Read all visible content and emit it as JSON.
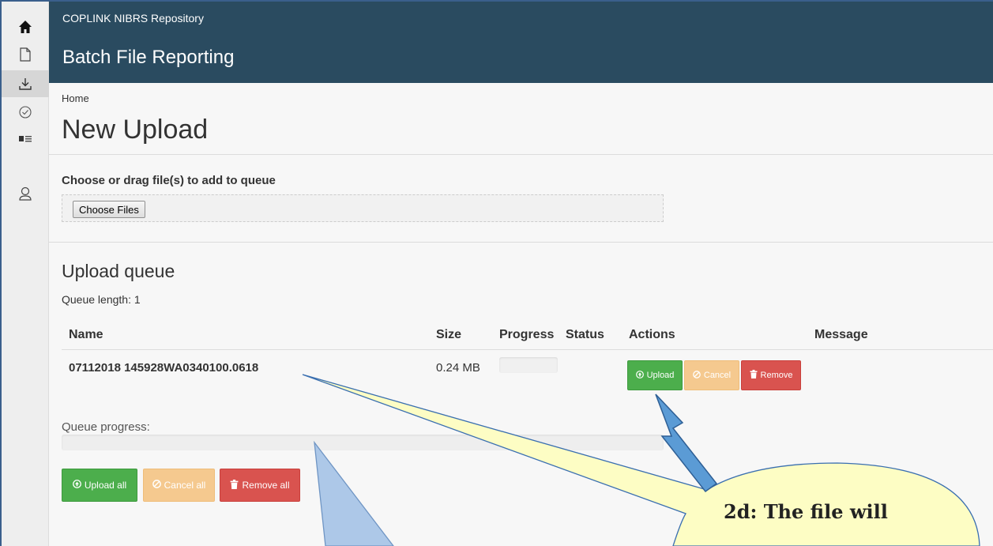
{
  "app": {
    "name": "COPLINK NIBRS Repository",
    "section_title": "Batch File Reporting"
  },
  "sidebar": {
    "items": [
      {
        "icon": "home-icon",
        "active": false
      },
      {
        "icon": "document-icon",
        "active": false
      },
      {
        "icon": "download-icon",
        "active": true
      },
      {
        "icon": "check-circle-icon",
        "active": false
      },
      {
        "icon": "list-icon",
        "active": false
      },
      {
        "icon": "user-icon",
        "active": false
      }
    ]
  },
  "breadcrumb": "Home",
  "page_title": "New Upload",
  "upload": {
    "label": "Choose or drag file(s) to add to queue",
    "choose_button": "Choose Files"
  },
  "queue": {
    "title": "Upload queue",
    "length_text": "Queue length: 1",
    "columns": {
      "name": "Name",
      "size": "Size",
      "progress": "Progress",
      "status": "Status",
      "actions": "Actions",
      "message": "Message"
    },
    "rows": [
      {
        "name": "07112018 145928WA0340100.0618",
        "size": "0.24 MB",
        "progress": 0,
        "status": "",
        "message": ""
      }
    ],
    "row_actions": {
      "upload": "Upload",
      "cancel": "Cancel",
      "remove": "Remove"
    },
    "progress_label": "Queue progress:",
    "progress_value": 0,
    "bulk_actions": {
      "upload_all": "Upload all",
      "cancel_all": "Cancel all",
      "remove_all": "Remove all"
    }
  },
  "annotation": {
    "callout_text": "2d: The file will"
  },
  "colors": {
    "header_bg": "#2a4b60",
    "success": "#4cae4c",
    "warning": "#f5c98f",
    "danger": "#d9534f",
    "callout_fill": "#fdfdc4",
    "callout_blue": "#adc8e8",
    "arrow_blue": "#5b9bd5"
  }
}
